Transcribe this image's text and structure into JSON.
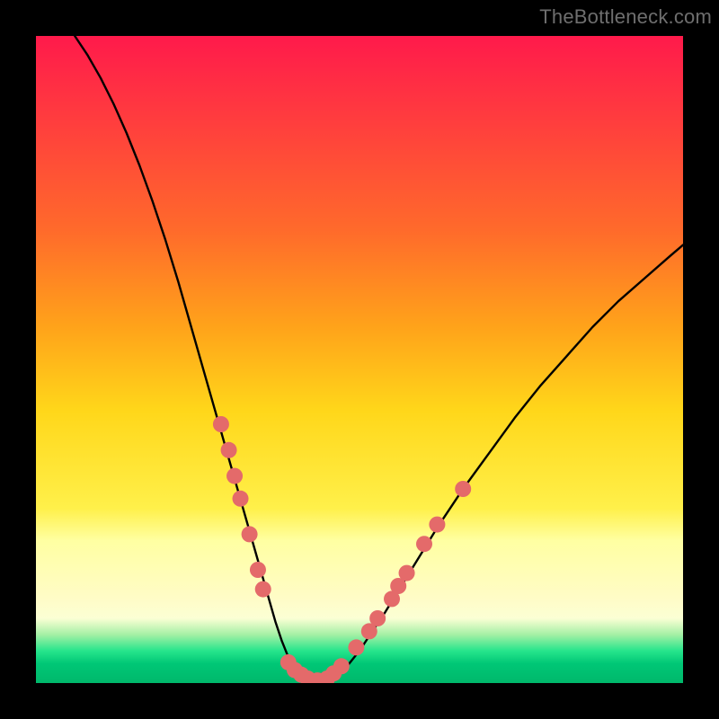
{
  "watermark": "TheBottleneck.com",
  "chart_data": {
    "type": "line",
    "title": "",
    "xlabel": "",
    "ylabel": "",
    "xlim": [
      0,
      100
    ],
    "ylim": [
      0,
      100
    ],
    "series": [
      {
        "name": "bottleneck-curve",
        "x": [
          6,
          8,
          10,
          12,
          14,
          16,
          18,
          20,
          22,
          24,
          26,
          28,
          30,
          32,
          34,
          36,
          37,
          38,
          39,
          40,
          41,
          42,
          43,
          44,
          46,
          48,
          50,
          54,
          58,
          62,
          66,
          70,
          74,
          78,
          82,
          86,
          90,
          94,
          98,
          100
        ],
        "y": [
          100,
          97,
          93.5,
          89.5,
          85,
          80,
          74.5,
          68.5,
          62,
          55,
          48,
          41,
          34,
          27,
          20,
          13,
          9.5,
          6.5,
          4,
          2.3,
          1.2,
          0.5,
          0.2,
          0.3,
          1,
          2.5,
          5,
          11,
          17.5,
          24,
          30,
          35.5,
          41,
          46,
          50.5,
          55,
          59,
          62.5,
          66,
          67.7
        ]
      }
    ],
    "markers": {
      "left_cluster": {
        "name": "points-left",
        "points": [
          [
            28.6,
            40.0
          ],
          [
            29.8,
            36.0
          ],
          [
            30.7,
            32.0
          ],
          [
            31.6,
            28.5
          ],
          [
            33.0,
            23.0
          ],
          [
            34.3,
            17.5
          ],
          [
            35.1,
            14.5
          ]
        ]
      },
      "bottom_cluster": {
        "name": "points-bottom",
        "points": [
          [
            39.0,
            3.2
          ],
          [
            40.0,
            2.0
          ],
          [
            41.0,
            1.3
          ],
          [
            42.0,
            0.7
          ],
          [
            43.5,
            0.4
          ],
          [
            45.0,
            0.7
          ],
          [
            46.0,
            1.5
          ],
          [
            47.2,
            2.6
          ]
        ]
      },
      "right_cluster": {
        "name": "points-right",
        "points": [
          [
            49.5,
            5.5
          ],
          [
            51.5,
            8.0
          ],
          [
            52.8,
            10.0
          ],
          [
            55.0,
            13.0
          ],
          [
            56.0,
            15.0
          ],
          [
            57.3,
            17.0
          ],
          [
            60.0,
            21.5
          ],
          [
            62.0,
            24.5
          ],
          [
            66.0,
            30.0
          ]
        ]
      }
    },
    "colors": {
      "curve": "#000000",
      "marker_fill": "#e46a6a",
      "marker_stroke": "#e46a6a"
    }
  }
}
